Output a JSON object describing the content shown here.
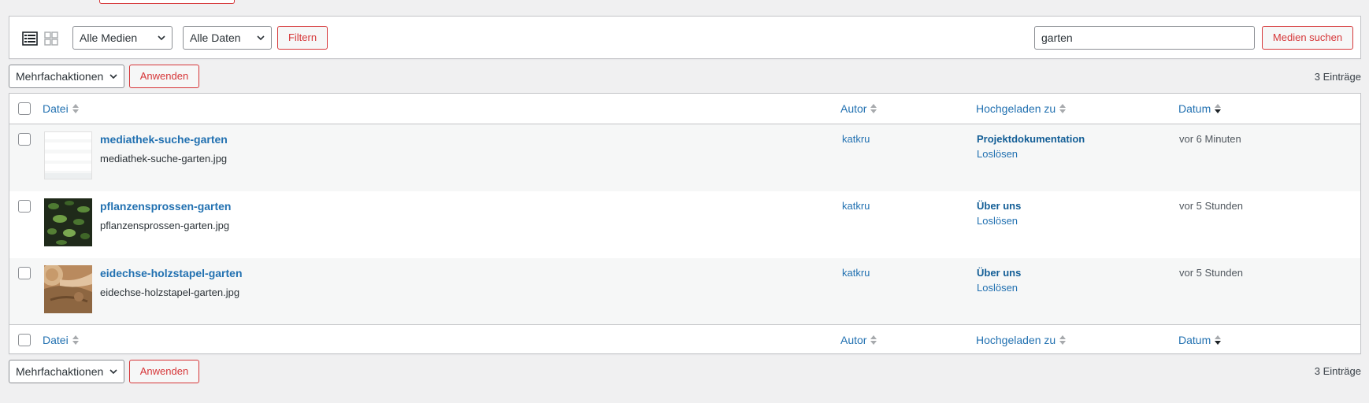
{
  "filters": {
    "media_type": "Alle Medien",
    "date": "Alle Daten",
    "filter_button": "Filtern",
    "search_value": "garten",
    "search_button": "Medien suchen"
  },
  "bulk": {
    "action_label": "Mehrfachaktionen",
    "apply_button": "Anwenden"
  },
  "count": "3 Einträge",
  "columns": {
    "file": "Datei",
    "author": "Autor",
    "uploaded_to": "Hochgeladen zu",
    "date": "Datum"
  },
  "rows": [
    {
      "title": "mediathek-suche-garten",
      "filename": "mediathek-suche-garten.jpg",
      "author": "katkru",
      "parent": "Projektdokumentation",
      "detach": "Loslösen",
      "date": "vor 6 Minuten",
      "thumbnail": "screenshot-thumbnail"
    },
    {
      "title": "pflanzensprossen-garten",
      "filename": "pflanzensprossen-garten.jpg",
      "author": "katkru",
      "parent": "Über uns",
      "detach": "Loslösen",
      "date": "vor 5 Stunden",
      "thumbnail": "plant-sprouts-thumbnail"
    },
    {
      "title": "eidechse-holzstapel-garten",
      "filename": "eidechse-holzstapel-garten.jpg",
      "author": "katkru",
      "parent": "Über uns",
      "detach": "Loslösen",
      "date": "vor 5 Stunden",
      "thumbnail": "lizard-woodpile-thumbnail"
    }
  ],
  "colors": {
    "link": "#2271b1",
    "danger": "#d63638",
    "border": "#c3c4c7",
    "background": "#f0f0f1",
    "row_alt": "#f6f7f7"
  }
}
